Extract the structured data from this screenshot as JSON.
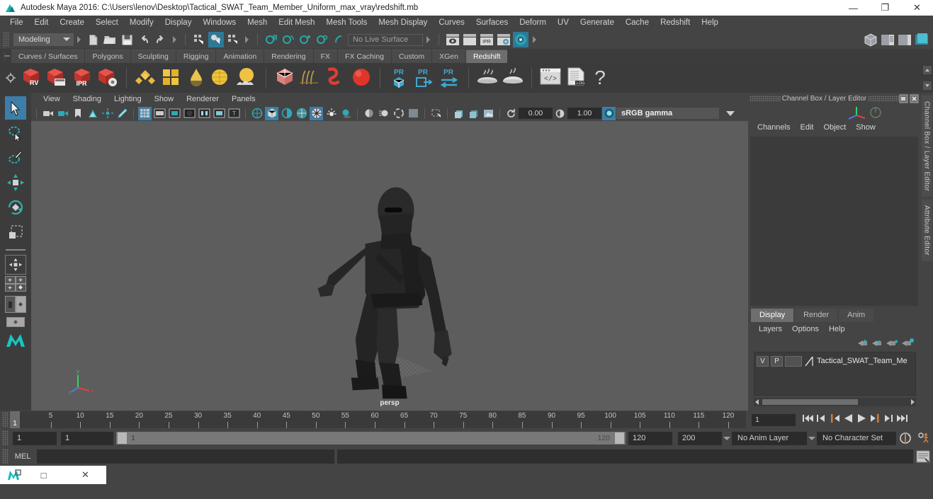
{
  "window": {
    "title": "Autodesk Maya 2016: C:\\Users\\lenov\\Desktop\\Tactical_SWAT_Team_Member_Uniform_max_vray\\redshift.mb",
    "minimize": "—",
    "maximize": "❐",
    "close": "✕"
  },
  "menubar": {
    "items": [
      "File",
      "Edit",
      "Create",
      "Select",
      "Modify",
      "Display",
      "Windows",
      "Mesh",
      "Edit Mesh",
      "Mesh Tools",
      "Mesh Display",
      "Curves",
      "Surfaces",
      "Deform",
      "UV",
      "Generate",
      "Cache",
      "Redshift",
      "Help"
    ]
  },
  "statusline": {
    "menuset": "Modeling",
    "live_surface": "No Live Surface",
    "icons": [
      "new-scene-icon",
      "open-scene-icon",
      "save-scene-icon",
      "undo-icon",
      "redo-icon",
      "select-by-hierarchy-icon",
      "select-by-object-icon",
      "select-by-component-icon",
      "snap-to-grid-icon",
      "snap-to-curve-icon",
      "snap-to-point-icon",
      "snap-to-projected-center-icon",
      "snap-to-view-plane-icon",
      "make-live-icon",
      "render-view-icon",
      "render-current-frame-icon",
      "ipr-render-icon",
      "render-settings-icon",
      "hypershade-icon"
    ]
  },
  "shelf": {
    "tabs": [
      "Curves / Surfaces",
      "Polygons",
      "Sculpting",
      "Rigging",
      "Animation",
      "Rendering",
      "FX",
      "FX Caching",
      "Custom",
      "XGen",
      "Redshift"
    ],
    "active_tab": "Redshift",
    "buttons": [
      {
        "name": "redshift-render-view",
        "label": "RV"
      },
      {
        "name": "redshift-render-sequence",
        "label": ""
      },
      {
        "name": "redshift-ipr",
        "label": "IPR"
      },
      {
        "name": "redshift-render-settings",
        "label": ""
      },
      {
        "name": "redshift-material",
        "label": ""
      },
      {
        "name": "redshift-material-blender",
        "label": ""
      },
      {
        "name": "redshift-incandescent",
        "label": ""
      },
      {
        "name": "redshift-sub-surface",
        "label": ""
      },
      {
        "name": "redshift-environment",
        "label": ""
      },
      {
        "name": "redshift-proxy",
        "label": ""
      },
      {
        "name": "redshift-hair",
        "label": ""
      },
      {
        "name": "redshift-curve",
        "label": ""
      },
      {
        "name": "redshift-sphere-light",
        "label": ""
      },
      {
        "name": "redshift-pr-object",
        "label": "PR"
      },
      {
        "name": "redshift-pr-export",
        "label": "PR"
      },
      {
        "name": "redshift-pr-transfer",
        "label": "PR"
      },
      {
        "name": "redshift-bake-left",
        "label": ""
      },
      {
        "name": "redshift-bake-right",
        "label": ""
      },
      {
        "name": "redshift-script-editor",
        "label": ""
      },
      {
        "name": "redshift-log",
        "label": ".LOG"
      },
      {
        "name": "redshift-help",
        "label": "?"
      }
    ]
  },
  "toolbox": {
    "tools": [
      "select-tool",
      "lasso-select-tool",
      "paint-select-tool",
      "move-tool",
      "rotate-tool",
      "scale-tool",
      "last-tool-used",
      "single-perspective-layout",
      "four-view-layout",
      "persp-outliner-layout",
      "hypergraph-layout",
      "maya-logo"
    ]
  },
  "viewport": {
    "menus": [
      "View",
      "Shading",
      "Lighting",
      "Show",
      "Renderer",
      "Panels"
    ],
    "camera_label": "persp",
    "exposure": "0.00",
    "gamma_value": "1.00",
    "color_profile": "sRGB gamma",
    "toolbar_icons": [
      "select-camera-icon",
      "camera-attributes-icon",
      "bookmark-icon",
      "image-plane-icon",
      "two-d-pan-zoom-icon",
      "grease-pencil-icon",
      "grid-toggle-icon",
      "film-gate-icon",
      "resolution-gate-icon",
      "gate-mask-icon",
      "film-origin-icon",
      "safe-action-icon",
      "safe-title-icon",
      "wireframe-icon",
      "smooth-shade-icon",
      "shade-all-icon",
      "wireframe-on-shaded-icon",
      "texture-toggle-icon",
      "use-all-lights-icon",
      "shadows-icon",
      "screen-space-ao-icon",
      "motion-blur-icon",
      "multisample-icon",
      "isolate-select-icon",
      "xray-icon",
      "xray-joints-icon",
      "xray-active-components-icon",
      "exposure-icon",
      "gamma-icon",
      "color-management-icon"
    ]
  },
  "channelbox": {
    "panel_title": "Channel Box / Layer Editor",
    "menus": [
      "Channels",
      "Edit",
      "Object",
      "Show"
    ],
    "float_icon": "undock-icon",
    "close_icon": "close-icon"
  },
  "layereditor": {
    "tabs": [
      "Display",
      "Render",
      "Anim"
    ],
    "active_tab": "Display",
    "menus": [
      "Layers",
      "Options",
      "Help"
    ],
    "buttons": [
      "move-layer-up-icon",
      "move-layer-down-icon",
      "new-layer-icon",
      "new-layer-from-selected-icon"
    ],
    "layers": [
      {
        "visibility": "V",
        "playback": "P",
        "type": "",
        "name": "Tactical_SWAT_Team_Me"
      }
    ]
  },
  "side_tabs": [
    "Channel Box / Layer Editor",
    "Attribute Editor"
  ],
  "timeline": {
    "current_frame": "1",
    "start_label": "1",
    "ticks": [
      5,
      10,
      15,
      20,
      25,
      30,
      35,
      40,
      45,
      50,
      55,
      60,
      65,
      70,
      75,
      80,
      85,
      90,
      95,
      100,
      105,
      110,
      115,
      120
    ],
    "playback_field": "1",
    "playback_buttons": [
      "go-to-start-icon",
      "step-back-frame-icon",
      "step-back-key-icon",
      "play-backwards-icon",
      "play-forwards-icon",
      "step-forward-key-icon",
      "step-forward-frame-icon",
      "go-to-end-icon"
    ]
  },
  "rangebar": {
    "anim_start": "1",
    "range_start": "1",
    "slider_min": "1",
    "slider_max": "120",
    "range_end": "120",
    "anim_end": "200",
    "anim_layer": "No Anim Layer",
    "character_set": "No Character Set",
    "auto_key_icon": "auto-keyframe-icon",
    "prefs_icon": "animation-preferences-icon"
  },
  "commandline": {
    "label": "MEL",
    "input_value": "",
    "output_value": "",
    "script_editor_icon": "script-editor-icon"
  },
  "taskbar": {
    "app_icon": "maya-app-icon",
    "restore": "□",
    "close": "✕"
  },
  "colors": {
    "accent_blue": "#3d7ea8",
    "teal": "#14b2b2",
    "shelf_bg": "#3b3b3b",
    "viewport_bg": "#5d5d5d",
    "panel_bg": "#444444"
  }
}
